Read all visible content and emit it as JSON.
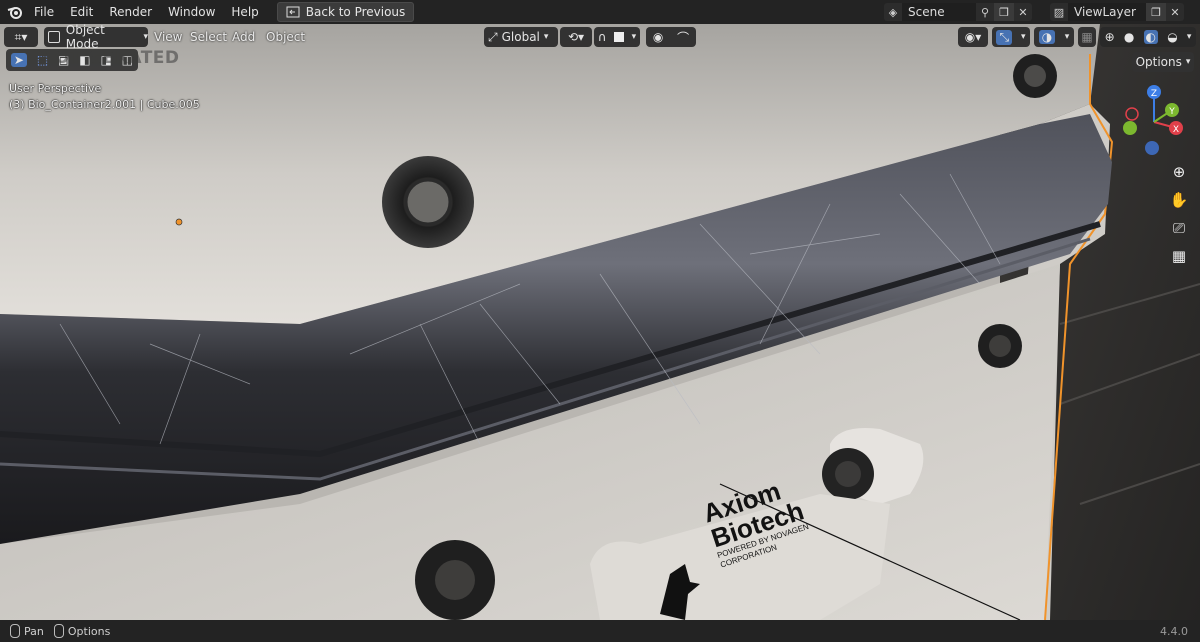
{
  "menu": {
    "file": "File",
    "edit": "Edit",
    "render": "Render",
    "window": "Window",
    "help": "Help",
    "back_button": "Back to Previous"
  },
  "scene": {
    "name": "Scene",
    "view_layer": "ViewLayer"
  },
  "viewport_header": {
    "mode": "Object Mode",
    "view": "View",
    "select": "Select",
    "add": "Add",
    "object": "Object",
    "transform_orientation": "Global",
    "options": "Options"
  },
  "overlay": {
    "perspective": "User Perspective",
    "object_info": "(3) Bio_Container2.001 | Cube.005",
    "watermark": "NOT GERATED"
  },
  "decal": {
    "line1": "Axiom",
    "line2": "Biotech",
    "line3": "POWERED BY NOVAGEN",
    "line4": "CORPORATION"
  },
  "gizmo": {
    "z": "Z",
    "y": "Y",
    "x": "X"
  },
  "status": {
    "pan": "Pan",
    "options": "Options",
    "version": "4.4.0"
  },
  "colors": {
    "accent": "#4772b3",
    "selection_outline": "#f0932b",
    "x_axis": "#e0404a",
    "y_axis": "#7cb82f",
    "z_axis": "#3d7ee6"
  }
}
